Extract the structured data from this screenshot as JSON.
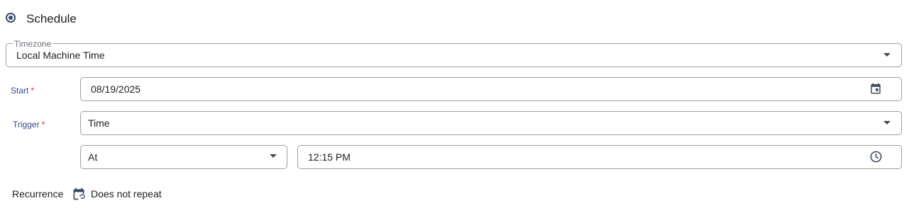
{
  "schedule": {
    "label": "Schedule",
    "selected": true
  },
  "timezone": {
    "legend": "Timezone",
    "value": "Local Machine Time"
  },
  "start": {
    "label": "Start",
    "required_mark": "*",
    "value": "08/19/2025"
  },
  "trigger": {
    "label": "Trigger",
    "required_mark": "*",
    "value": "Time"
  },
  "at_select": {
    "value": "At"
  },
  "time_input": {
    "value": "12:15 PM"
  },
  "recurrence": {
    "label": "Recurrence",
    "value": "Does not repeat"
  },
  "icons": {
    "dropdown": "chevron-down-icon",
    "calendar": "calendar-icon",
    "clock": "clock-icon",
    "recurrence": "calendar-repeat-icon"
  },
  "colors": {
    "accent": "#3b4a6b",
    "label": "#3b4a8a",
    "required": "#d93025",
    "border": "#9a9ea6"
  }
}
